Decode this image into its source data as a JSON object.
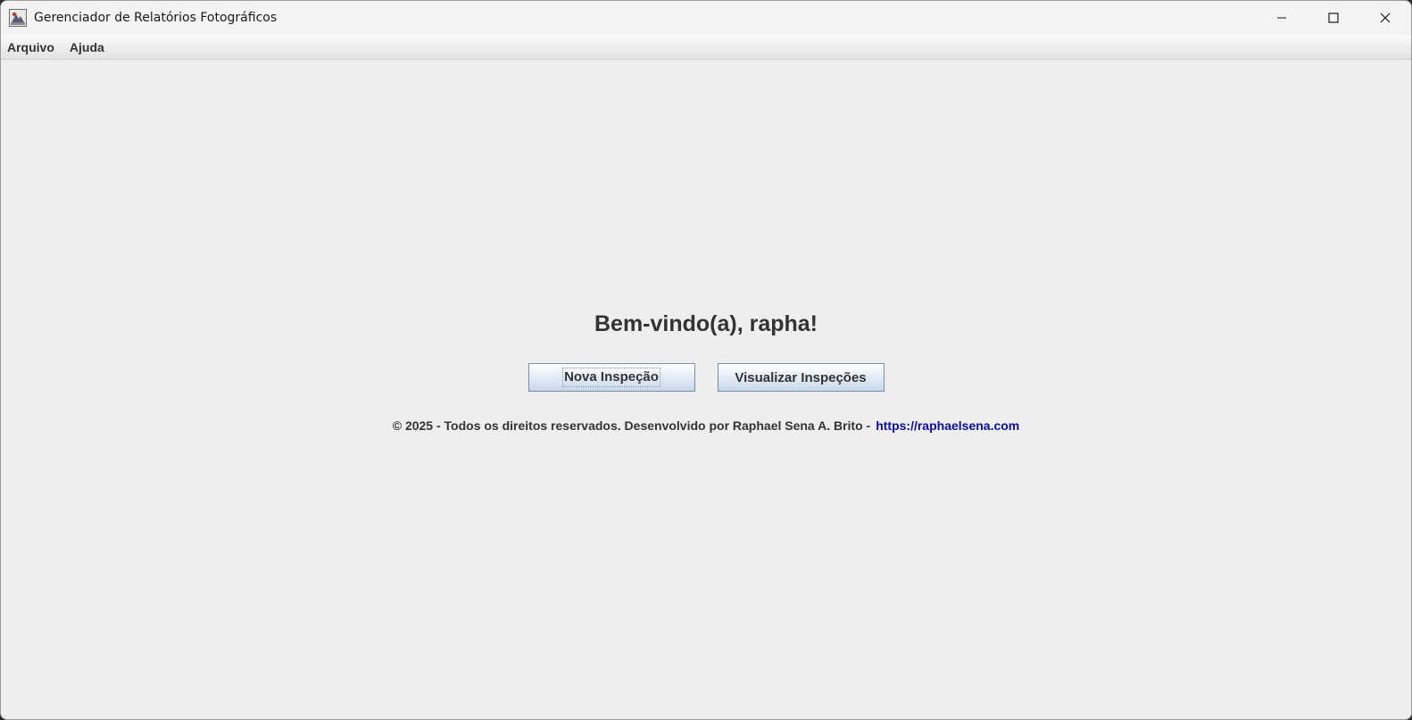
{
  "window": {
    "title": "Gerenciador de Relatórios Fotográficos"
  },
  "menu": {
    "items": [
      "Arquivo",
      "Ajuda"
    ]
  },
  "main": {
    "welcome": "Bem-vindo(a), rapha!",
    "buttons": {
      "new_inspection": "Nova Inspeção",
      "view_inspections": "Visualizar Inspeções"
    },
    "footer": {
      "text": "© 2025 - Todos os direitos reservados. Desenvolvido por Raphael Sena A. Brito -",
      "link": "https://raphaelsena.com"
    }
  },
  "colors": {
    "background": "#eeeeee",
    "link": "#0b0ba8",
    "text": "#333333",
    "button_border": "#7a8ea8"
  }
}
